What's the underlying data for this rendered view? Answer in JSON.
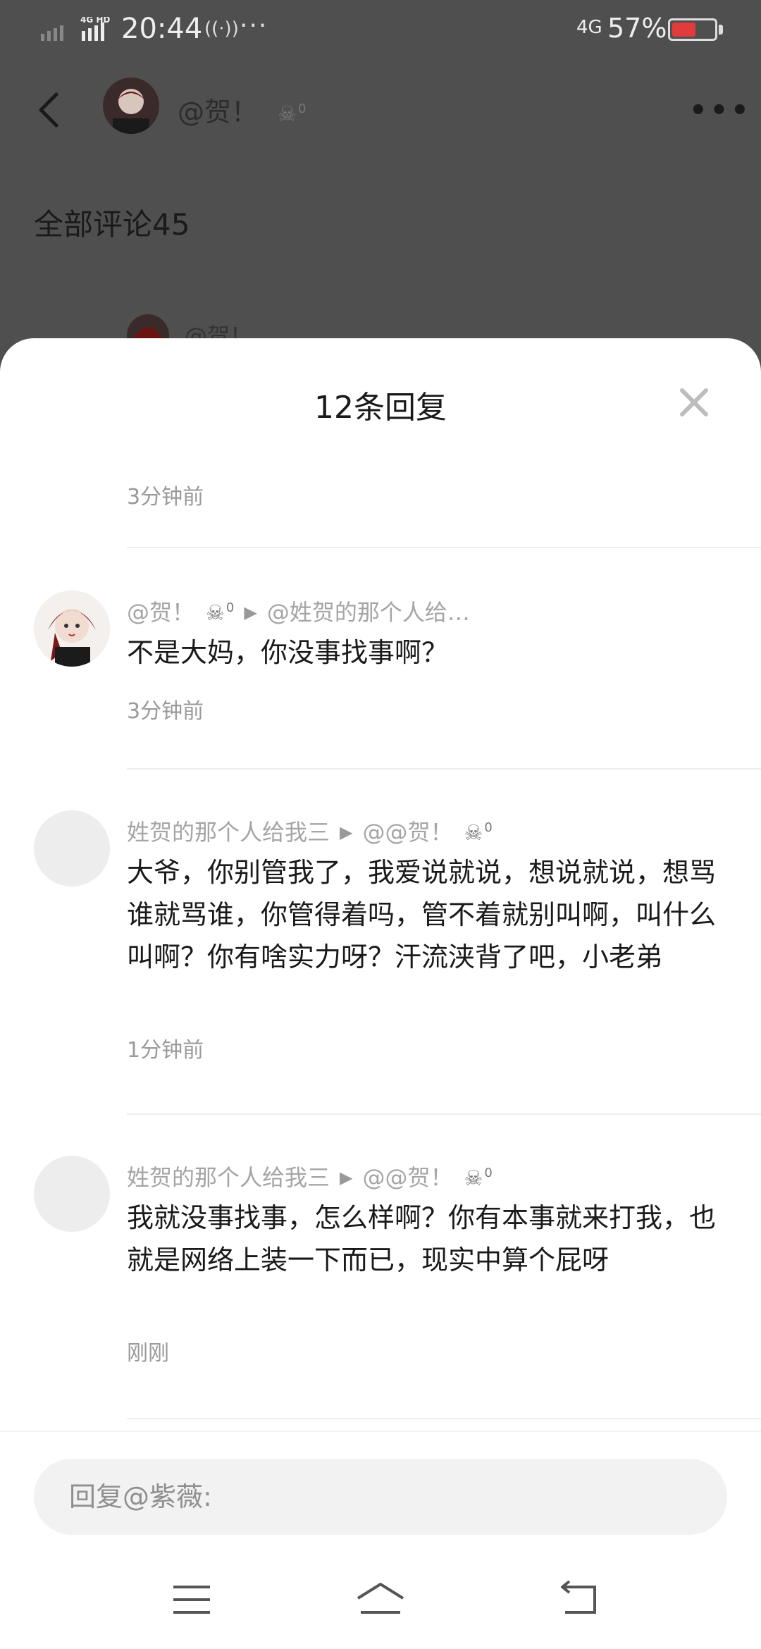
{
  "status_bar": {
    "network_type": "4G HD",
    "time": "20:44",
    "nfc": "((·))",
    "dots": "···",
    "network_right": "4G",
    "battery_percent": "57%",
    "battery_level": 0.57,
    "battery_color": "#e23b3b"
  },
  "background": {
    "username": "@贺！",
    "skull_level": "0",
    "more_label": "•••",
    "all_comments": "全部评论45",
    "peek_username": "@贺！"
  },
  "sheet": {
    "title": "12条回复",
    "top_time": "3分钟前",
    "comments": [
      {
        "author": "@贺！",
        "skull_level": "0",
        "reply_to": "@姓贺的那个人给…",
        "text": "不是大妈，你没事找事啊？",
        "time": "3分钟前"
      },
      {
        "author": "姓贺的那个人给我三",
        "reply_to": "@@贺！",
        "skull_level": "0",
        "text": "大爷，你别管我了，我爱说就说，想说就说，想骂谁就骂谁，你管得着吗，管不着就别叫啊，叫什么叫啊？你有啥实力呀？汗流浃背了吧，小老弟",
        "time": "1分钟前"
      },
      {
        "author": "姓贺的那个人给我三",
        "reply_to": "@@贺！",
        "skull_level": "0",
        "text": "我就没事找事，怎么样啊？你有本事就来打我，也就是网络上装一下而已，现实中算个屁呀",
        "time": "刚刚"
      }
    ]
  },
  "reply_input": {
    "placeholder": "回复@紫薇:"
  },
  "icons": {
    "skull": "skull-crossbones-icon",
    "arrow": "play-arrow-icon"
  }
}
